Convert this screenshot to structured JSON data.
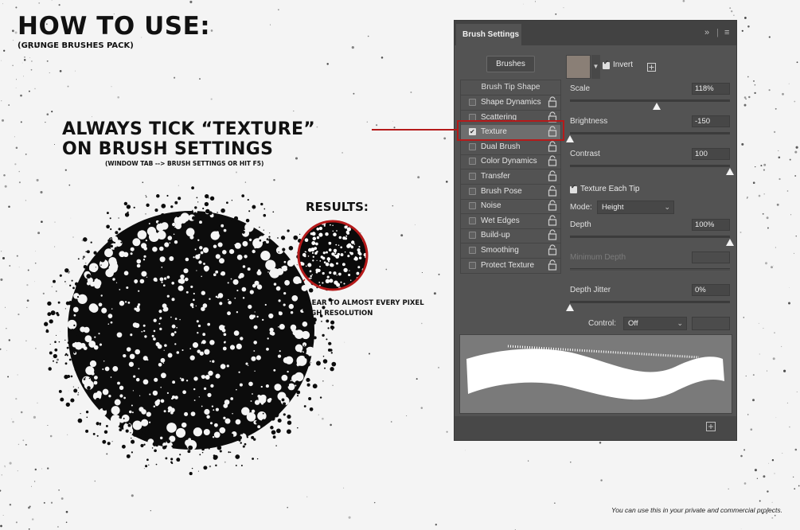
{
  "guide": {
    "title": "HOW TO USE:",
    "subtitle": "(GRUNGE BRUSHES PACK)",
    "instruction_line1": "ALWAYS TICK “TEXTURE”",
    "instruction_line2": "ON BRUSH SETTINGS",
    "instruction_hint": "(WINDOW TAB --> BRUSH SETTINGS OR HIT F5)",
    "results_label": "RESULTS:",
    "result_note1": "CLEAR TO ALMOST EVERY PIXEL",
    "result_note2": "HIGH RESOLUTION",
    "footer": "You can use this in your private and commercial projects."
  },
  "panel": {
    "tab_title": "Brush Settings",
    "collapse_icon": "double-chevron-icon",
    "menu_icon": "hamburger-menu-icon",
    "brushes_button": "Brushes",
    "options_header": "Brush Tip Shape",
    "options": [
      {
        "label": "Shape Dynamics",
        "checked": false
      },
      {
        "label": "Scattering",
        "checked": false
      },
      {
        "label": "Texture",
        "checked": true
      },
      {
        "label": "Dual Brush",
        "checked": false
      },
      {
        "label": "Color Dynamics",
        "checked": false
      },
      {
        "label": "Transfer",
        "checked": false
      },
      {
        "label": "Brush Pose",
        "checked": false
      },
      {
        "label": "Noise",
        "checked": false
      },
      {
        "label": "Wet Edges",
        "checked": false
      },
      {
        "label": "Build-up",
        "checked": false
      },
      {
        "label": "Smoothing",
        "checked": false
      },
      {
        "label": "Protect Texture",
        "checked": false
      }
    ],
    "invert_label": "Invert",
    "invert_checked": true,
    "scale": {
      "label": "Scale",
      "value": "118%",
      "slider_fraction": 0.54
    },
    "brightness": {
      "label": "Brightness",
      "value": "-150",
      "slider_fraction": 0.0
    },
    "contrast": {
      "label": "Contrast",
      "value": "100",
      "slider_fraction": 1.0
    },
    "texture_each_tip": {
      "label": "Texture Each Tip",
      "checked": true
    },
    "mode": {
      "label": "Mode:",
      "value": "Height"
    },
    "depth": {
      "label": "Depth",
      "value": "100%",
      "slider_fraction": 1.0
    },
    "minimum_depth": {
      "label": "Minimum Depth",
      "value": ""
    },
    "depth_jitter": {
      "label": "Depth Jitter",
      "value": "0%",
      "slider_fraction": 0.0
    },
    "control": {
      "label": "Control:",
      "value": "Off"
    },
    "accent_red": "#b51a1a"
  }
}
